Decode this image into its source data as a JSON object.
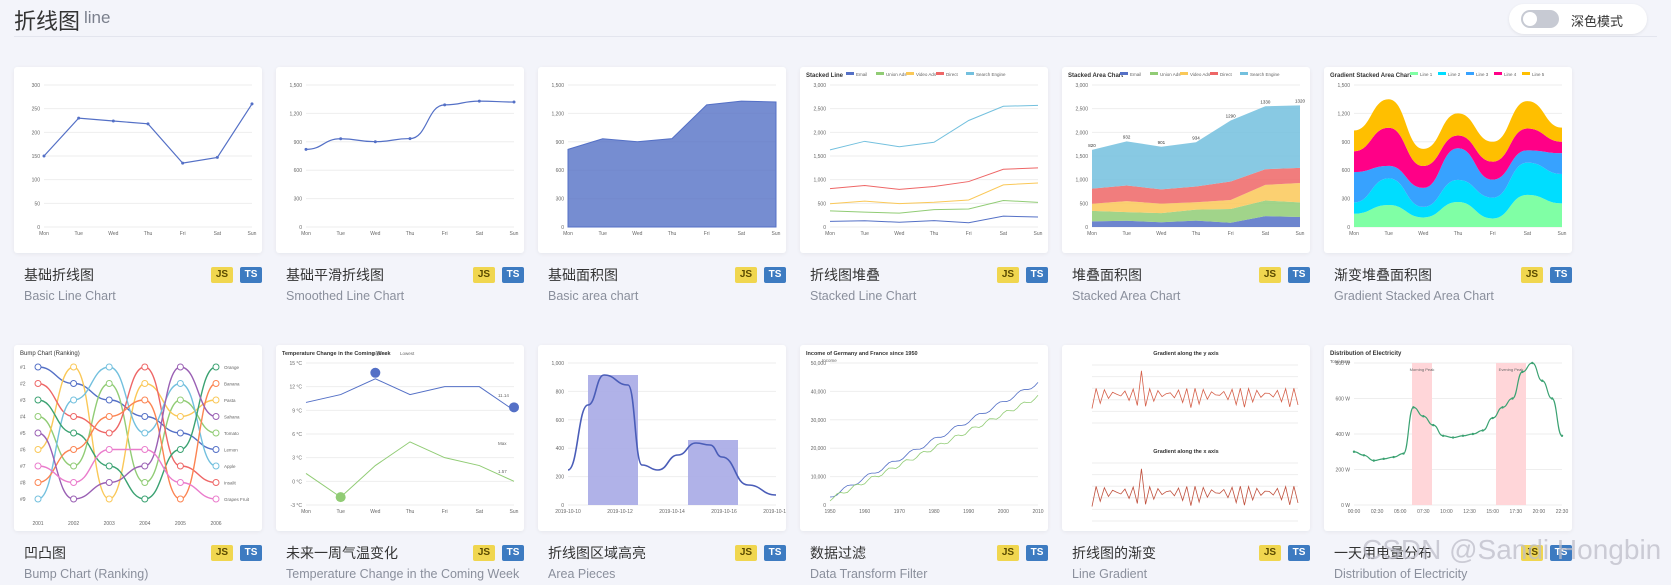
{
  "header": {
    "title": "折线图",
    "subtitle": "line",
    "dark_mode_label": "深色模式",
    "dark_mode_on": false
  },
  "badges": {
    "js": "JS",
    "ts": "TS"
  },
  "watermark": "CSDN @Sandi Hongbin",
  "cards": [
    {
      "name": "基础折线图",
      "en": "Basic Line Chart",
      "thumb": "basic-line"
    },
    {
      "name": "基础平滑折线图",
      "en": "Smoothed Line Chart",
      "thumb": "smooth-line"
    },
    {
      "name": "基础面积图",
      "en": "Basic area chart",
      "thumb": "area"
    },
    {
      "name": "折线图堆叠",
      "en": "Stacked Line Chart",
      "thumb": "stacked-line"
    },
    {
      "name": "堆叠面积图",
      "en": "Stacked Area Chart",
      "thumb": "stacked-area"
    },
    {
      "name": "渐变堆叠面积图",
      "en": "Gradient Stacked Area Chart",
      "thumb": "gradient-stacked"
    },
    {
      "name": "凹凸图",
      "en": "Bump Chart (Ranking)",
      "thumb": "bump"
    },
    {
      "name": "未来一周气温变化",
      "en": "Temperature Change in the Coming Week",
      "thumb": "temperature"
    },
    {
      "name": "折线图区域高亮",
      "en": "Area Pieces",
      "thumb": "area-pieces"
    },
    {
      "name": "数据过滤",
      "en": "Data Transform Filter",
      "thumb": "filter"
    },
    {
      "name": "折线图的渐变",
      "en": "Line Gradient",
      "thumb": "line-gradient"
    },
    {
      "name": "一天用电量分布",
      "en": "Distribution of Electricity",
      "thumb": "electricity"
    }
  ],
  "thumbs": {
    "basic-line": {
      "days": [
        "Mon",
        "Tue",
        "Wed",
        "Thu",
        "Fri",
        "Sat",
        "Sun"
      ],
      "values": [
        150,
        230,
        224,
        218,
        135,
        147,
        260
      ],
      "yticks": [
        "0",
        "50",
        "100",
        "150",
        "200",
        "250",
        "300"
      ]
    },
    "smooth-line": {
      "days": [
        "Mon",
        "Tue",
        "Wed",
        "Thu",
        "Fri",
        "Sat",
        "Sun"
      ],
      "values": [
        820,
        932,
        901,
        934,
        1290,
        1330,
        1320
      ],
      "yticks": [
        "0",
        "300",
        "600",
        "900",
        "1,200",
        "1,500"
      ]
    },
    "area": {
      "days": [
        "Mon",
        "Tue",
        "Wed",
        "Thu",
        "Fri",
        "Sat",
        "Sun"
      ],
      "values": [
        820,
        932,
        901,
        934,
        1290,
        1330,
        1320
      ],
      "yticks": [
        "0",
        "300",
        "600",
        "900",
        "1,200",
        "1,500"
      ]
    },
    "stacked-line": {
      "title": "Stacked Line",
      "legend": [
        "Email",
        "Union Ads",
        "Video Ads",
        "Direct",
        "Search Engine"
      ]
    },
    "stacked-area": {
      "title": "Stacked Area Chart",
      "legend": [
        "Email",
        "Union Ads",
        "Video Ads",
        "Direct",
        "Search Engine"
      ],
      "labels": [
        "820",
        "932",
        "901",
        "934",
        "1290",
        "1330",
        "1320"
      ]
    },
    "gradient-stacked": {
      "title": "Gradient Stacked Area Chart",
      "legend": [
        "Line 1",
        "Line 2",
        "Line 3",
        "Line 4",
        "Line 5"
      ]
    },
    "bump": {
      "title": "Bump Chart (Ranking)",
      "ranks": [
        "#1",
        "#2",
        "#3",
        "#4",
        "#5",
        "#6",
        "#7",
        "#8",
        "#9"
      ],
      "years": [
        "2001",
        "2002",
        "2003",
        "2004",
        "2005",
        "2006"
      ],
      "names": [
        "Orange",
        "Banana",
        "Pasta",
        "Sahana",
        "Tomato",
        "Lemon",
        "Apple",
        "Insalit",
        "Grapes Fruit"
      ]
    },
    "temperature": {
      "title": "Temperature Change in the Coming Week",
      "legend": [
        "Highest",
        "Lowest"
      ],
      "yticks": [
        "15 °C",
        "12 °C",
        "9 °C",
        "6 °C",
        "3 °C",
        "0 °C",
        "-3 °C"
      ],
      "labels": [
        "11.14",
        "Max",
        "1.57"
      ]
    },
    "area-pieces": {
      "yticks": [
        "0",
        "200",
        "400",
        "600",
        "800",
        "1,000"
      ],
      "dates": [
        "2019-10-10",
        "2019-10-12",
        "2019-10-14",
        "2019-10-16",
        "2019-10-18"
      ]
    },
    "filter": {
      "title": "Income of Germany and France since 1950",
      "ylabel": "Income",
      "years": [
        "1950",
        "1960",
        "1970",
        "1980",
        "1990",
        "2000",
        "2010"
      ]
    },
    "line-gradient": {
      "title1": "Gradient along the y axis",
      "title2": "Gradient along the x axis"
    },
    "electricity": {
      "title": "Distribution of Electricity",
      "ylabel": "Total Data",
      "marks": [
        "Morning Peak",
        "Evening Peak"
      ],
      "yticks": [
        "800 W",
        "600 W",
        "400 W",
        "200 W",
        "0 W"
      ]
    }
  },
  "colors": {
    "blue": "#5470c6",
    "green": "#91cc75",
    "yellow": "#fac858",
    "red": "#ee6666",
    "cyan": "#73c0de",
    "teal": "#3ba272",
    "orange": "#fc8452",
    "purple": "#9a60b4",
    "pink": "#ea7ccc"
  }
}
